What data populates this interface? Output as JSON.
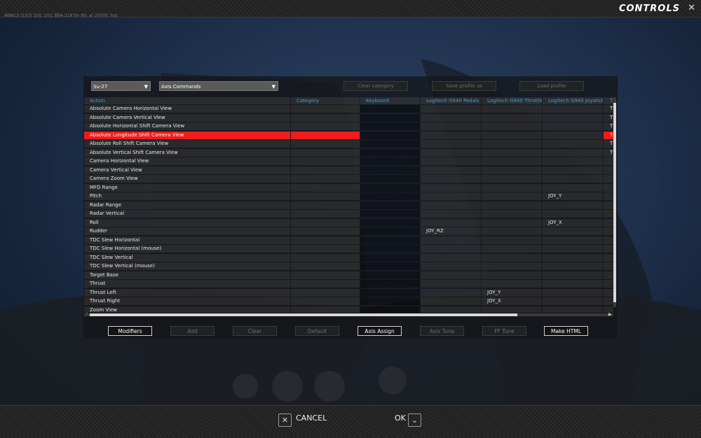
{
  "header": {
    "title": "CONTROLS",
    "close_glyph": "✕",
    "hud_text": "AWACS (103) 103, 103, BRA 218 for 80, at 20000, hot"
  },
  "toolbar": {
    "aircraft": "Su-27",
    "category": "Axis Commands",
    "clear_category": "Clear category",
    "save_profile_as": "Save profile as",
    "load_profile": "Load profile"
  },
  "table": {
    "columns": [
      "Action",
      "Category",
      "Keyboard",
      "Logitech G940 Pedals",
      "Logitech G940 Throttle",
      "Logitech G940 Joystick",
      "T"
    ],
    "rows": [
      {
        "action": "Absolute Camera Horizontal View",
        "pedals": "",
        "throttle": "",
        "joystick": "",
        "more": "T"
      },
      {
        "action": "Absolute Camera Vertical View",
        "pedals": "",
        "throttle": "",
        "joystick": "",
        "more": "T"
      },
      {
        "action": "Absolute Horizontal Shift Camera View",
        "pedals": "",
        "throttle": "",
        "joystick": "",
        "more": "T"
      },
      {
        "action": "Absolute Longitude Shift Camera View",
        "pedals": "",
        "throttle": "",
        "joystick": "",
        "more": "TR",
        "selected": true
      },
      {
        "action": "Absolute Roll Shift Camera View",
        "pedals": "",
        "throttle": "",
        "joystick": "",
        "more": "T"
      },
      {
        "action": "Absolute Vertical Shift Camera View",
        "pedals": "",
        "throttle": "",
        "joystick": "",
        "more": "T"
      },
      {
        "action": "Camera Horizontal View",
        "pedals": "",
        "throttle": "",
        "joystick": "",
        "more": ""
      },
      {
        "action": "Camera Vertical View",
        "pedals": "",
        "throttle": "",
        "joystick": "",
        "more": ""
      },
      {
        "action": "Camera Zoom View",
        "pedals": "",
        "throttle": "",
        "joystick": "",
        "more": ""
      },
      {
        "action": "MFD Range",
        "pedals": "",
        "throttle": "",
        "joystick": "",
        "more": ""
      },
      {
        "action": "Pitch",
        "pedals": "",
        "throttle": "",
        "joystick": "JOY_Y",
        "more": ""
      },
      {
        "action": "Radar Range",
        "pedals": "",
        "throttle": "",
        "joystick": "",
        "more": ""
      },
      {
        "action": "Radar Vertical",
        "pedals": "",
        "throttle": "",
        "joystick": "",
        "more": ""
      },
      {
        "action": "Roll",
        "pedals": "",
        "throttle": "",
        "joystick": "JOY_X",
        "more": ""
      },
      {
        "action": "Rudder",
        "pedals": "JOY_RZ",
        "throttle": "",
        "joystick": "",
        "more": ""
      },
      {
        "action": "TDC Slew Horizontal",
        "pedals": "",
        "throttle": "",
        "joystick": "",
        "more": ""
      },
      {
        "action": "TDC Slew Horizontal (mouse)",
        "pedals": "",
        "throttle": "",
        "joystick": "",
        "more": ""
      },
      {
        "action": "TDC Slew Vertical",
        "pedals": "",
        "throttle": "",
        "joystick": "",
        "more": ""
      },
      {
        "action": "TDC Slew Vertical (mouse)",
        "pedals": "",
        "throttle": "",
        "joystick": "",
        "more": ""
      },
      {
        "action": "Target Base",
        "pedals": "",
        "throttle": "",
        "joystick": "",
        "more": ""
      },
      {
        "action": "Thrust",
        "pedals": "",
        "throttle": "",
        "joystick": "",
        "more": ""
      },
      {
        "action": "Thrust Left",
        "pedals": "",
        "throttle": "JOY_Y",
        "joystick": "",
        "more": ""
      },
      {
        "action": "Thrust Right",
        "pedals": "",
        "throttle": "JOY_X",
        "joystick": "",
        "more": ""
      },
      {
        "action": "Zoom View",
        "pedals": "",
        "throttle": "",
        "joystick": "",
        "more": ""
      }
    ]
  },
  "actions": {
    "modifiers": "Modifiers",
    "add": "Add",
    "clear": "Clear",
    "default": "Default",
    "axis_assign": "Axis Assign",
    "axis_tune": "Axis Tune",
    "ff_tune": "FF Tune",
    "make_html": "Make HTML"
  },
  "footer": {
    "cancel": "CANCEL",
    "ok": "OK"
  },
  "colors": {
    "selection": "#f01b1b",
    "header_text": "#3fa0d6"
  }
}
